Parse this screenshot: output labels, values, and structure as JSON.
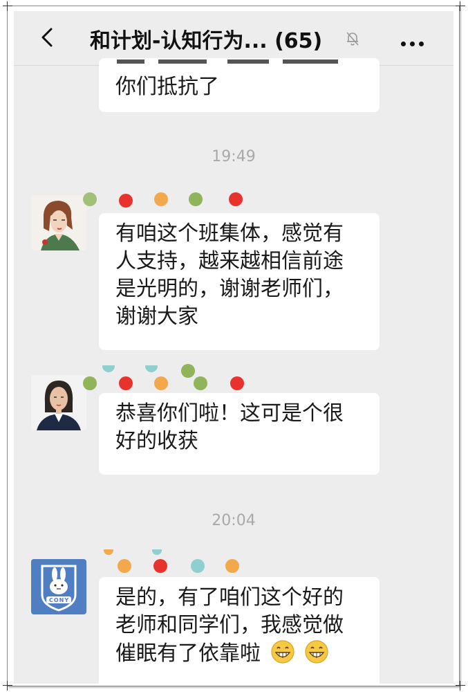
{
  "header": {
    "title": "和计划-认知行为... (65)",
    "back_icon": "chevron-left-icon",
    "mute_icon": "bell-slash-icon",
    "more_icon": "more-dots-icon"
  },
  "messages": [
    {
      "type": "text",
      "lines": [
        "你们抵抗了"
      ]
    },
    {
      "type": "time",
      "text": "19:49"
    },
    {
      "type": "text",
      "avatar": "avatar-illustrated-woman",
      "lines": [
        "有咱这个班集体，感觉有",
        "人支持，越来越相信前途",
        "是光明的，谢谢老师们，",
        "谢谢大家"
      ]
    },
    {
      "type": "text",
      "avatar": "avatar-woman-photo",
      "lines": [
        "恭喜你们啦！这可是个很",
        "好的收获"
      ]
    },
    {
      "type": "time",
      "text": "20:04"
    },
    {
      "type": "text",
      "avatar": "avatar-bunny",
      "lines": [
        "是的，有了咱们这个好的",
        "老师和同学们，我感觉做",
        "催眠有了依靠啦"
      ],
      "emoji": [
        "grin-emoji",
        "grin-emoji"
      ]
    }
  ],
  "avatar_bunny_badge": "CONY",
  "colors": {
    "dot_green": "#8fb45a",
    "dot_red": "#e8322c",
    "dot_orange": "#f3a84c",
    "dot_teal": "#8fcfd0",
    "screen_bg": "#ededed",
    "bubble_bg": "#ffffff"
  }
}
